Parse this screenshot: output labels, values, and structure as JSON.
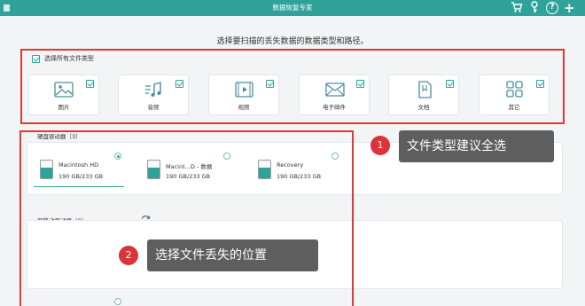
{
  "app": {
    "title": "数据恢复专家"
  },
  "toolbar": {
    "cart_icon": "shopping-cart-icon",
    "key_icon": "key-icon",
    "help_label": "?",
    "add_label": "+"
  },
  "subtitle": "选择要扫描的丢失数据的数据类型和路径。",
  "categories": {
    "select_all_label": "选择所有文件类型",
    "items": [
      {
        "label": "图片",
        "icon": "image-icon",
        "checked": true
      },
      {
        "label": "音频",
        "icon": "audio-icon",
        "checked": true
      },
      {
        "label": "视频",
        "icon": "video-icon",
        "checked": true
      },
      {
        "label": "电子邮件",
        "icon": "email-icon",
        "checked": true
      },
      {
        "label": "文档",
        "icon": "document-icon",
        "checked": true
      },
      {
        "label": "其它",
        "icon": "other-icon",
        "checked": true
      }
    ]
  },
  "drives": {
    "hard_drives_label": "硬盘驱动器（3）",
    "items": [
      {
        "name": "Macintosh HD",
        "size": "190 GB/233 GB",
        "selected": true
      },
      {
        "name": "Macint...D - 数据",
        "size": "190 GB/233 GB",
        "selected": false
      },
      {
        "name": "Recovery",
        "size": "190 GB/233 GB",
        "selected": false
      }
    ],
    "removable_label": "可移动驱动器（0）"
  },
  "annotations": {
    "one_number": "1",
    "one_text": "文件类型建议全选",
    "two_number": "2",
    "two_text": "选择文件丢失的位置"
  },
  "colors": {
    "accent": "#2fa39a",
    "highlight": "#e0383a",
    "tooltip": "#5e5e5e"
  }
}
